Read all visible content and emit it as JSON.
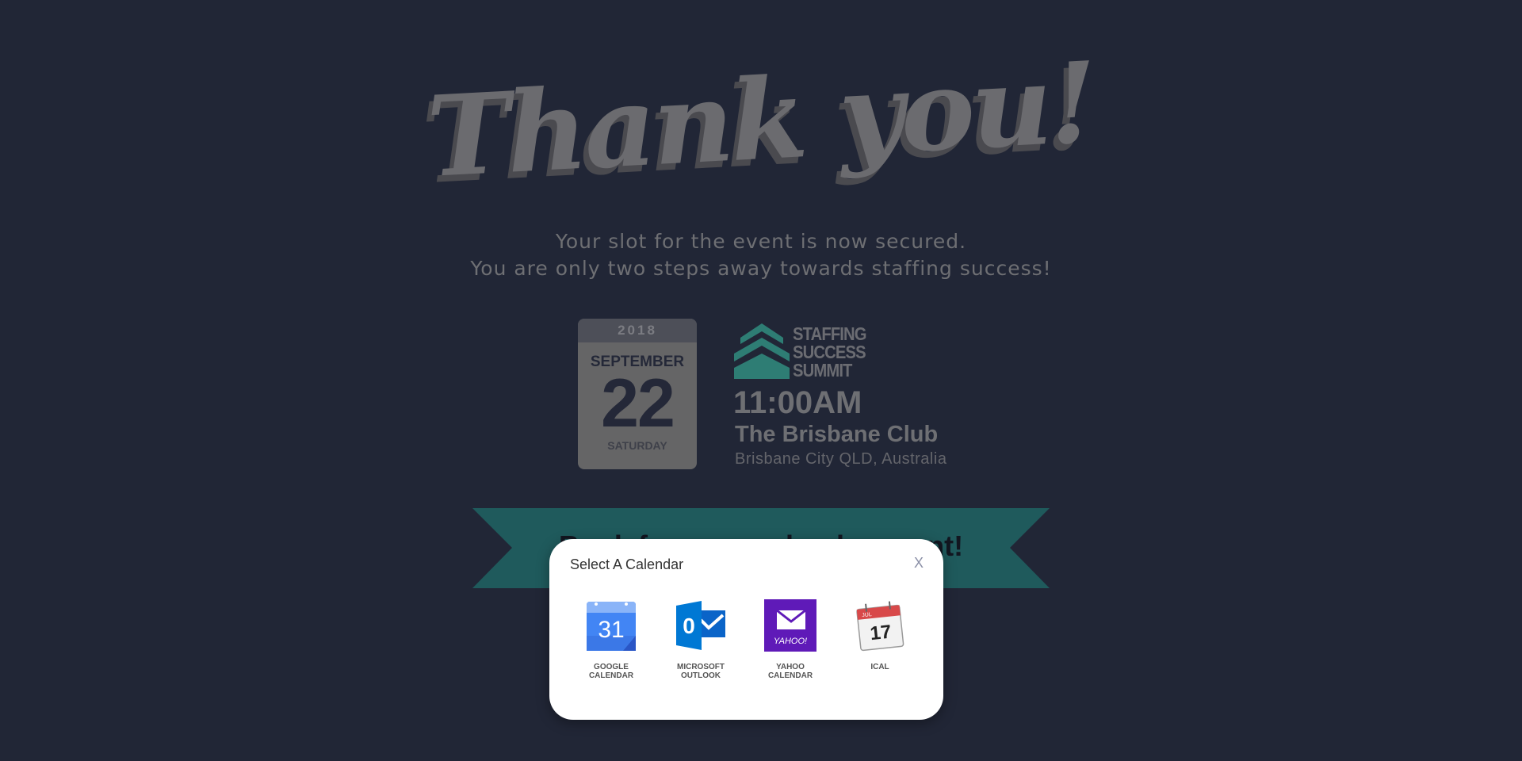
{
  "header": {
    "title": "Thank you!",
    "subtitle_line1": "Your slot for the event is now secured.",
    "subtitle_line2": "You are only two steps away towards staffing success!"
  },
  "event": {
    "year": "2018",
    "month": "SEPTEMBER",
    "day": "22",
    "weekday": "SATURDAY",
    "logo_lines": [
      "STAFFING",
      "SUCCESS",
      "SUMMIT"
    ],
    "time": "11:00AM",
    "venue": "The Brisbane Club",
    "location": "Brisbane City QLD, Australia"
  },
  "ribbon": {
    "text": "Book for your calendar event!",
    "color": "#1f5a5c"
  },
  "modal": {
    "title": "Select A Calendar",
    "close_label": "X",
    "options": [
      {
        "label": "GOOGLE CALENDAR",
        "icon": "google-calendar-icon",
        "glyph": "31"
      },
      {
        "label": "MICROSOFT OUTLOOK",
        "icon": "outlook-icon",
        "glyph": "0"
      },
      {
        "label": "YAHOO CALENDAR",
        "icon": "yahoo-calendar-icon",
        "glyph": "YAHOO!"
      },
      {
        "label": "ICAL",
        "icon": "ical-icon",
        "glyph": "17",
        "month": "JUL"
      }
    ]
  },
  "colors": {
    "background": "#212636",
    "accent_teal": "#1f5a5c",
    "logo_teal": "#2e7d74"
  }
}
